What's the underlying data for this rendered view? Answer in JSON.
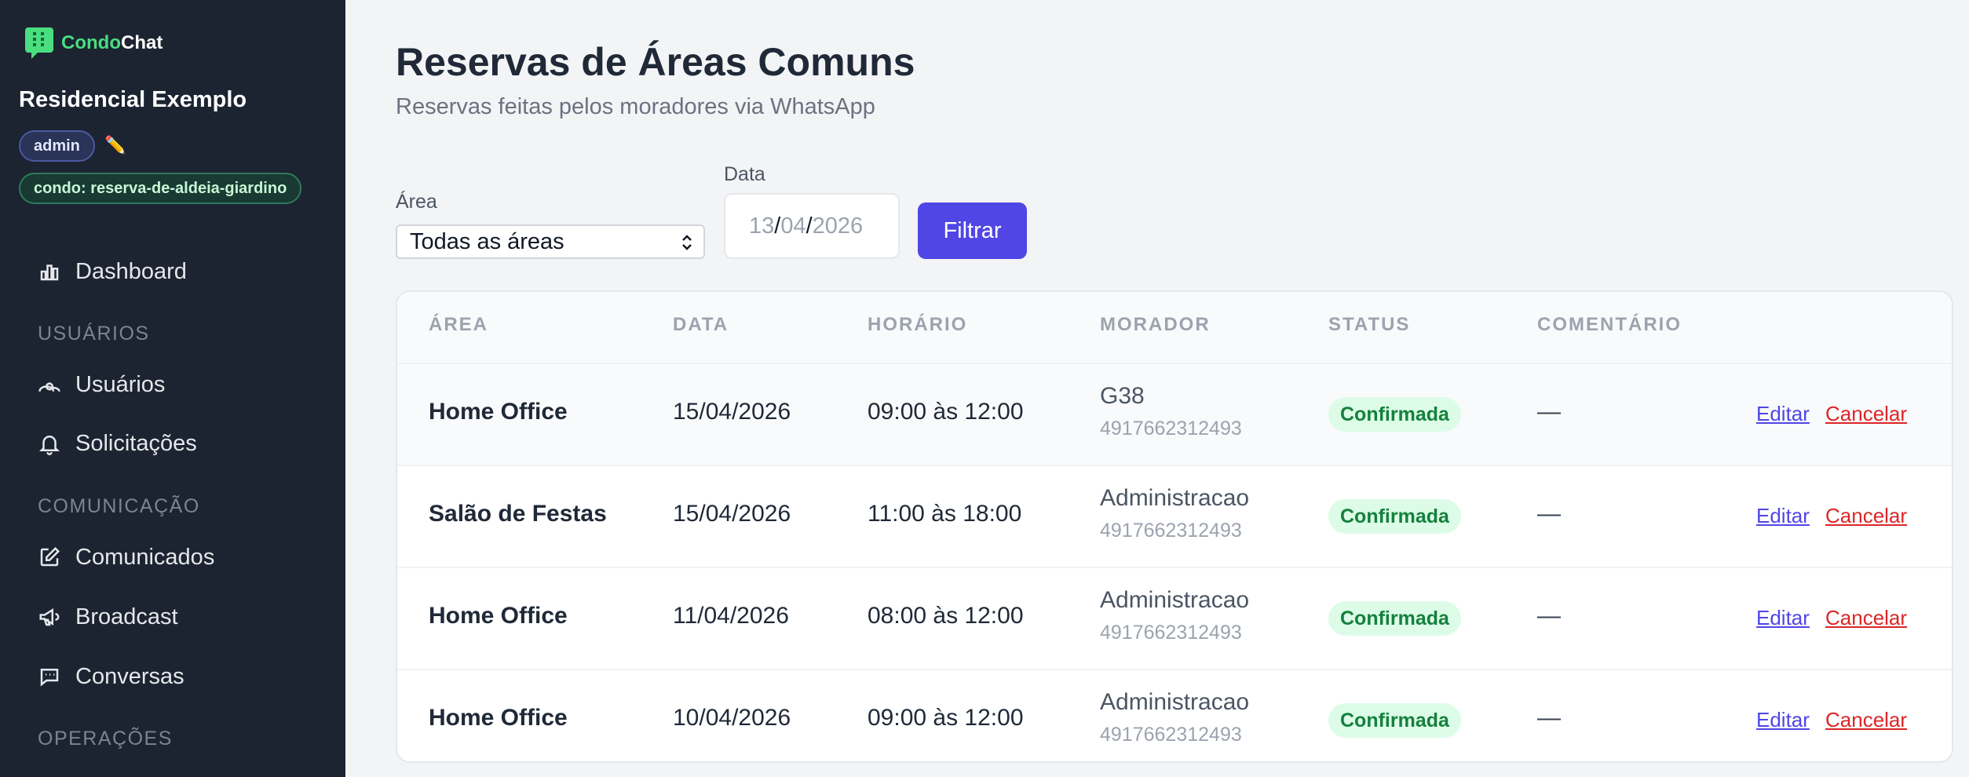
{
  "sidebar": {
    "brand_prefix": "Condo",
    "brand_suffix": "Chat",
    "condo_name": "Residencial Exemplo",
    "role_badge": "admin",
    "condo_badge": "condo: reserva-de-aldeia-giardino",
    "nav": {
      "dashboard": "Dashboard",
      "section_usuarios": "USUÁRIOS",
      "usuarios": "Usuários",
      "solicitacoes": "Solicitações",
      "section_comunicacao": "COMUNICAÇÃO",
      "comunicados": "Comunicados",
      "broadcast": "Broadcast",
      "conversas": "Conversas",
      "section_operacoes": "OPERAÇÕES"
    },
    "icons": [
      "chart-bar-icon",
      "users-icon",
      "bell-icon",
      "edit-square-icon",
      "megaphone-icon",
      "chat-icon"
    ]
  },
  "header": {
    "title": "Reservas de Áreas Comuns",
    "subtitle": "Reservas feitas pelos moradores via WhatsApp"
  },
  "filters": {
    "area_label": "Área",
    "area_selected": "Todas as áreas",
    "date_label": "Data",
    "date_day": "13",
    "date_month": "04",
    "date_year": "2026",
    "submit_label": "Filtrar"
  },
  "table": {
    "headers": {
      "area": "ÁREA",
      "data": "DATA",
      "horario": "HORÁRIO",
      "morador": "MORADOR",
      "status": "STATUS",
      "comentario": "COMENTÁRIO"
    },
    "rows": [
      {
        "area": "Home Office",
        "data": "15/04/2026",
        "horario": "09:00 às 12:00",
        "morador": "G38",
        "telefone": "4917662312493",
        "status": "Confirmada",
        "comentario": "—",
        "edit": "Editar",
        "cancel": "Cancelar"
      },
      {
        "area": "Salão de Festas",
        "data": "15/04/2026",
        "horario": "11:00 às 18:00",
        "morador": "Administracao",
        "telefone": "4917662312493",
        "status": "Confirmada",
        "comentario": "—",
        "edit": "Editar",
        "cancel": "Cancelar"
      },
      {
        "area": "Home Office",
        "data": "11/04/2026",
        "horario": "08:00 às 12:00",
        "morador": "Administracao",
        "telefone": "4917662312493",
        "status": "Confirmada",
        "comentario": "—",
        "edit": "Editar",
        "cancel": "Cancelar"
      },
      {
        "area": "Home Office",
        "data": "10/04/2026",
        "horario": "09:00 às 12:00",
        "morador": "Administracao",
        "telefone": "4917662312493",
        "status": "Confirmada",
        "comentario": "—",
        "edit": "Editar",
        "cancel": "Cancelar"
      }
    ]
  },
  "colors": {
    "sidebar_bg": "#1c2331",
    "brand_accent": "#4ade80",
    "primary": "#4f46e5",
    "status_ok_bg": "#dcfce7",
    "status_ok_text": "#15803d",
    "danger": "#dc2626"
  }
}
